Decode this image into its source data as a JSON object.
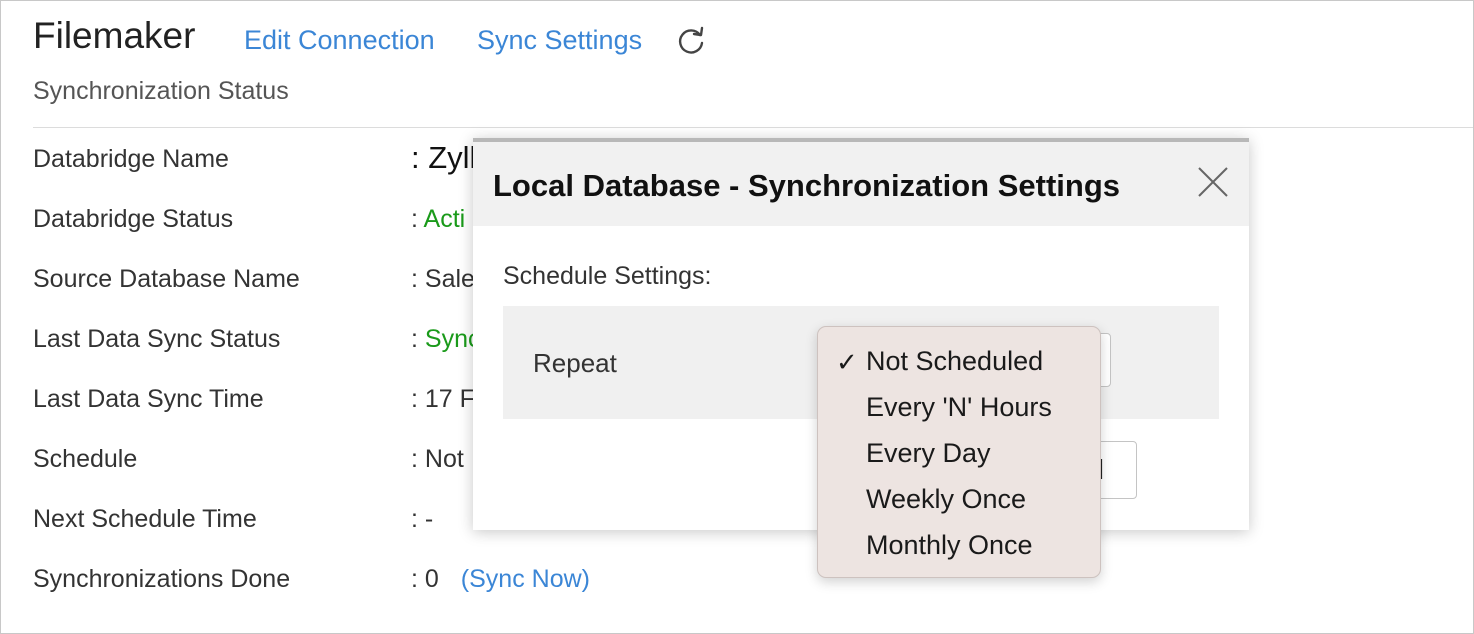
{
  "header": {
    "app_title": "Filemaker",
    "edit_connection": "Edit Connection",
    "sync_settings": "Sync Settings",
    "subtitle": "Synchronization Status"
  },
  "details": {
    "rows": [
      {
        "label": "Databridge Name",
        "value": ": Zyll"
      },
      {
        "label": "Databridge Status",
        "colon": ": ",
        "value": "Acti"
      },
      {
        "label": "Source Database Name",
        "value": ": Sale"
      },
      {
        "label": "Last Data Sync Status",
        "colon": ": ",
        "value": "Sync"
      },
      {
        "label": "Last Data Sync Time",
        "value": ": 17 F"
      },
      {
        "label": "Schedule",
        "value": ": Not"
      },
      {
        "label": "Next Schedule Time",
        "value": ": -"
      },
      {
        "label": "Synchronizations Done",
        "value": ": 0",
        "link": "(Sync Now)"
      }
    ]
  },
  "modal": {
    "title": "Local Database - Synchronization Settings",
    "schedule_settings_label": "Schedule Settings:",
    "repeat_label": "Repeat",
    "button_partial": "l"
  },
  "dropdown": {
    "selected": "Not Scheduled",
    "options": [
      "Not Scheduled",
      "Every 'N' Hours",
      "Every Day",
      "Weekly Once",
      "Monthly Once"
    ]
  },
  "colors": {
    "link": "#3b86d6",
    "status_green": "#1a9a1a",
    "dropdown_bg": "#ede4e1"
  }
}
